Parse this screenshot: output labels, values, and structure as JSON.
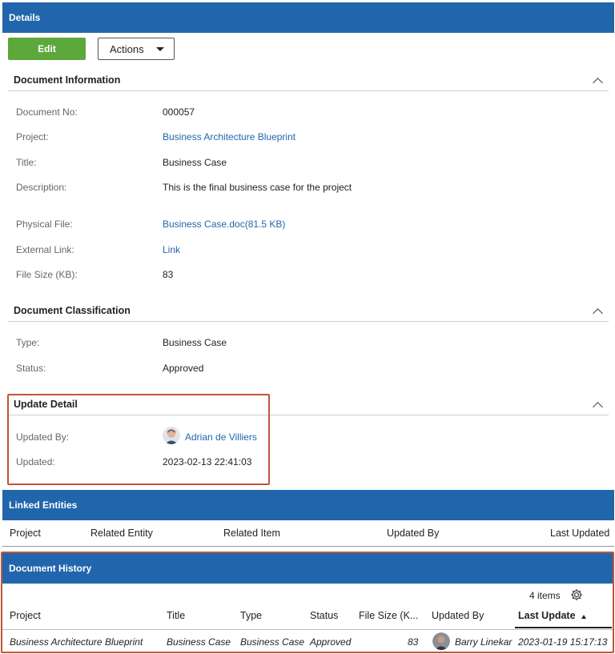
{
  "details": {
    "header": "Details",
    "edit_label": "Edit",
    "actions_label": "Actions",
    "doc_info": {
      "title": "Document Information",
      "fields": [
        {
          "label": "Document No:",
          "value": "000057"
        },
        {
          "label": "Project:",
          "value": "Business Architecture Blueprint"
        },
        {
          "label": "Title:",
          "value": "Business Case"
        },
        {
          "label": "Description:",
          "value": "This is the final business case for the project"
        },
        {
          "label": "Physical File:",
          "value": "Business Case.doc(81.5 KB)"
        },
        {
          "label": "External Link:",
          "value": "Link"
        },
        {
          "label": "File Size (KB):",
          "value": "83"
        }
      ]
    },
    "classification": {
      "title": "Document Classification",
      "fields": [
        {
          "label": "Type:",
          "value": "Business Case"
        },
        {
          "label": "Status:",
          "value": "Approved"
        }
      ]
    },
    "update_detail": {
      "title": "Update Detail",
      "updated_by_label": "Updated By:",
      "updated_by_value": "Adrian de Villiers",
      "updated_label": "Updated:",
      "updated_value": "2023-02-13 22:41:03"
    }
  },
  "linked_entities": {
    "header": "Linked Entities",
    "columns": [
      "Project",
      "Related Entity",
      "Related Item",
      "Updated By",
      "Last Updated"
    ]
  },
  "document_history": {
    "header": "Document History",
    "item_count": "4 items",
    "columns": [
      "Project",
      "Title",
      "Type",
      "Status",
      "File Size (K...",
      "Updated By",
      "Last Update"
    ],
    "rows": [
      {
        "project": "Business Architecture Blueprint",
        "title": "Business Case",
        "type": "Business Case",
        "status": "Approved",
        "size": "83",
        "updated_by": "Barry Linekar",
        "last_update": "2023-01-19 15:17:13"
      }
    ]
  },
  "colors": {
    "header_blue": "#2166ac",
    "edit_green": "#5ca83b",
    "highlight": "#c0563a",
    "link": "#2166ac"
  },
  "icons": [
    "chevron-up-icon",
    "caret-down-icon",
    "gear-icon",
    "sort-ascending-icon"
  ]
}
